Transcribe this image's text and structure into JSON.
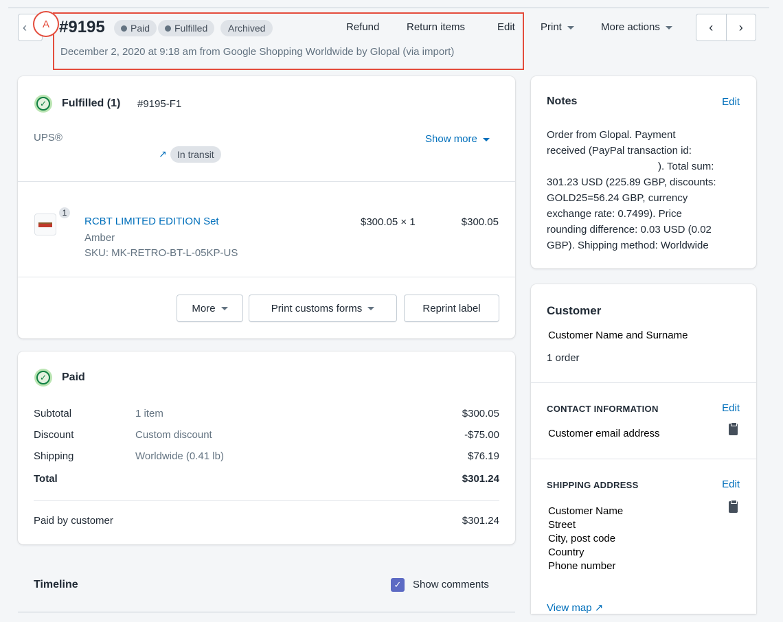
{
  "marker": "A",
  "header": {
    "order_number": "#9195",
    "badges": [
      "Paid",
      "Fulfilled",
      "Archived"
    ],
    "actions": [
      "Refund",
      "Return items",
      "Edit"
    ],
    "print_label": "Print",
    "more_actions_label": "More actions",
    "subtitle": "December 2, 2020 at 9:18 am from Google Shopping Worldwide by Glopal (via import)"
  },
  "fulfillment": {
    "title": "Fulfilled (1)",
    "id": "#9195-F1",
    "carrier": "UPS®",
    "show_more": "Show more",
    "tracking_status": "In transit",
    "item": {
      "qty_badge": "1",
      "name": "RCBT LIMITED EDITION Set",
      "variant": "Amber",
      "sku": "SKU: MK-RETRO-BT-L-05KP-US",
      "unit_price": "$300.05 × 1",
      "line_total": "$300.05"
    },
    "buttons": {
      "more": "More",
      "print_customs": "Print customs forms",
      "reprint": "Reprint label"
    }
  },
  "payment": {
    "title": "Paid",
    "rows": [
      {
        "label": "Subtotal",
        "detail": "1 item",
        "amount": "$300.05"
      },
      {
        "label": "Discount",
        "detail": "Custom discount",
        "amount": "-$75.00"
      },
      {
        "label": "Shipping",
        "detail": "Worldwide (0.41 lb)",
        "amount": "$76.19"
      }
    ],
    "total_label": "Total",
    "total_amount": "$301.24",
    "paid_label": "Paid by customer",
    "paid_amount": "$301.24"
  },
  "timeline": {
    "title": "Timeline",
    "show_comments": "Show comments",
    "show_comments_checked": true
  },
  "notes": {
    "title": "Notes",
    "edit": "Edit",
    "lines": [
      "Order from Glopal. Payment",
      "received (PayPal transaction id:",
      "). Total sum:",
      "301.23 USD (225.89 GBP, discounts:",
      "GOLD25=56.24 GBP, currency",
      "exchange rate: 0.7499). Price",
      "rounding difference: 0.03 USD (0.02",
      "GBP). Shipping method: Worldwide"
    ]
  },
  "customer": {
    "title": "Customer",
    "name": "Customer Name and Surname",
    "orders": "1 order",
    "contact_title": "CONTACT INFORMATION",
    "contact_edit": "Edit",
    "email": "Customer email address",
    "shipping_title": "SHIPPING ADDRESS",
    "shipping_edit": "Edit",
    "address": [
      "Customer Name",
      "Street",
      "City, post code",
      "Country",
      "Phone number"
    ],
    "view_map": "View map"
  }
}
